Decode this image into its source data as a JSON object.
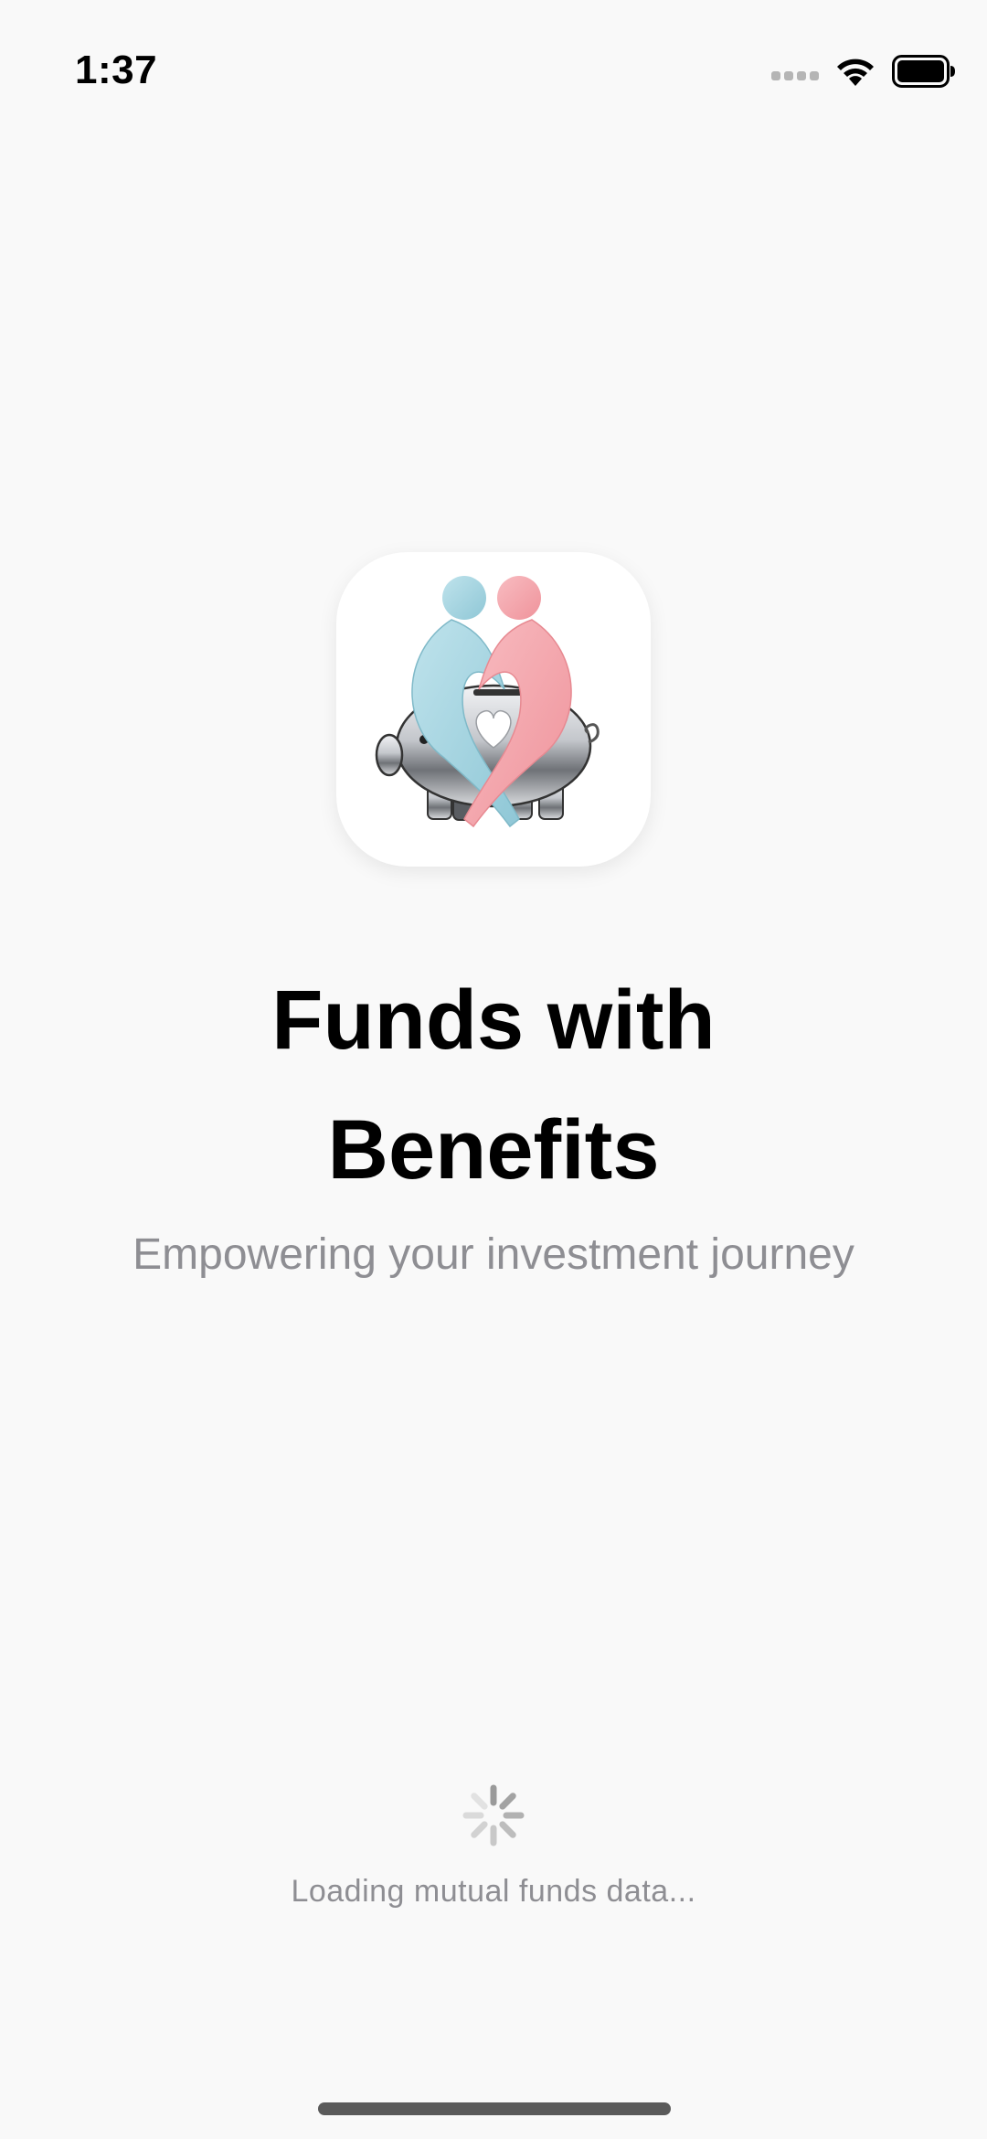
{
  "status_bar": {
    "time": "1:37",
    "icons": [
      "cellular-signal-icon",
      "wifi-icon",
      "battery-full-icon"
    ]
  },
  "splash": {
    "app_icon": "piggy-bank-heart-logo-icon",
    "title": "Funds with Benefits",
    "subtitle": "Empowering your investment journey",
    "loading_text": "Loading mutual funds data..."
  },
  "colors": {
    "background": "#f9f9f9",
    "title": "#000000",
    "subtitle": "#8e8e93",
    "logo_blue": "#a8d8e4",
    "logo_pink": "#f5a6ad",
    "pig_silver": "#b9bcc1"
  }
}
